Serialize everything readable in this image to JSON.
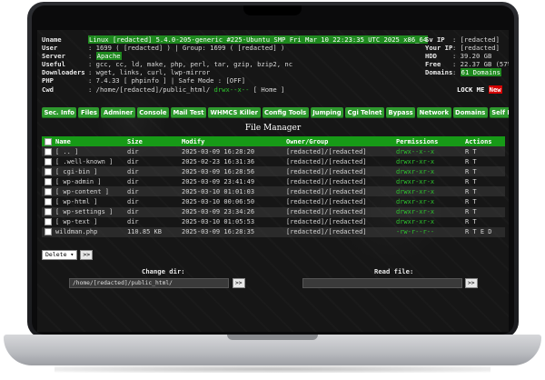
{
  "server_info": {
    "left": [
      {
        "label": "Uname",
        "value": "Linux [redacted] 5.4.0-205-generic #225-Ubuntu SMP Fri Mar 10 22:23:35 UTC 2025 x86_64"
      },
      {
        "label": "User",
        "value": ": 1699 ( [redacted] ) | Group: 1699 ( [redacted] )"
      },
      {
        "label": "Server",
        "value": "Apache"
      },
      {
        "label": "Useful",
        "value": ": gcc, cc, ld, make, php, perl, tar, gzip, bzip2, nc"
      },
      {
        "label": "Downloaders",
        "value": ": wget, links, curl, lwp-mirror"
      },
      {
        "label": "PHP",
        "value": ": 7.4.33 [ phpinfo ] | Safe Mode : [OFF]"
      },
      {
        "label": "Cwd",
        "value": ": /home/[redacted]/public_html/",
        "perm": "drwx--x--",
        "extra": "[ Home ]"
      }
    ],
    "right": [
      {
        "label": "Sv IP",
        "value": ": [redacted]"
      },
      {
        "label": "Your IP",
        "value": ": [redacted]"
      },
      {
        "label": "HDD",
        "value": ": 39.20 GB"
      },
      {
        "label": "Free",
        "value": ": 22.37 GB (57%)"
      },
      {
        "label": "Domains",
        "value": "61 Domains"
      }
    ],
    "server_prefix": ": ",
    "lock_label": "LOCK ME",
    "new_badge": "New"
  },
  "menu": [
    "Sec. Info",
    "Files",
    "Adminer",
    "Console",
    "Mail Test",
    "WHMCS Killer",
    "Config Tools",
    "Jumping",
    "Cgi Telnet",
    "Bypass",
    "Network",
    "Domains",
    "Self Remove"
  ],
  "file_manager": {
    "title": "File Manager",
    "columns": [
      "Name",
      "Size",
      "Modify",
      "Owner/Group",
      "Permissions",
      "Actions"
    ],
    "rows": [
      {
        "name": "[ .. ]",
        "size": "dir",
        "modify": "2025-03-09 16:28:20",
        "owner": "[redacted]/[redacted]",
        "perms": "drwx--x--x",
        "actions": "R T"
      },
      {
        "name": "[ .well-known ]",
        "size": "dir",
        "modify": "2025-02-23 16:31:36",
        "owner": "[redacted]/[redacted]",
        "perms": "drwxr-xr-x",
        "actions": "R T"
      },
      {
        "name": "[ cgi-bin ]",
        "size": "dir",
        "modify": "2025-03-09 16:28:56",
        "owner": "[redacted]/[redacted]",
        "perms": "drwxr-xr-x",
        "actions": "R T"
      },
      {
        "name": "[ wp-admin ]",
        "size": "dir",
        "modify": "2025-03-09 23:41:49",
        "owner": "[redacted]/[redacted]",
        "perms": "drwxr-xr-x",
        "actions": "R T"
      },
      {
        "name": "[ wp-content ]",
        "size": "dir",
        "modify": "2025-03-10 01:01:03",
        "owner": "[redacted]/[redacted]",
        "perms": "drwxr-xr-x",
        "actions": "R T"
      },
      {
        "name": "[ wp-html ]",
        "size": "dir",
        "modify": "2025-03-10 00:06:50",
        "owner": "[redacted]/[redacted]",
        "perms": "drwxr-xr-x",
        "actions": "R T"
      },
      {
        "name": "[ wp-settings ]",
        "size": "dir",
        "modify": "2025-03-09 23:34:26",
        "owner": "[redacted]/[redacted]",
        "perms": "drwxr-xr-x",
        "actions": "R T"
      },
      {
        "name": "[ wp-text ]",
        "size": "dir",
        "modify": "2025-03-10 01:05:53",
        "owner": "[redacted]/[redacted]",
        "perms": "drwxr-xr-x",
        "actions": "R T"
      },
      {
        "name": "wildman.php",
        "size": "110.85 KB",
        "modify": "2025-03-09 16:28:35",
        "owner": "[redacted]/[redacted]",
        "perms": "-rw-r--r--",
        "actions": "R T E D"
      }
    ],
    "bulk_action": "Delete",
    "bulk_go": ">>"
  },
  "change_dir": {
    "label": "Change dir:",
    "value": "/home/[redacted]/public_html/",
    "go": ">>"
  },
  "read_file": {
    "label": "Read file:",
    "value": "",
    "go": ">>"
  },
  "colors": {
    "accent": "#1f9a1f",
    "perm_green": "#2ec42e",
    "new_badge": "#d40000",
    "background": "#161616"
  }
}
